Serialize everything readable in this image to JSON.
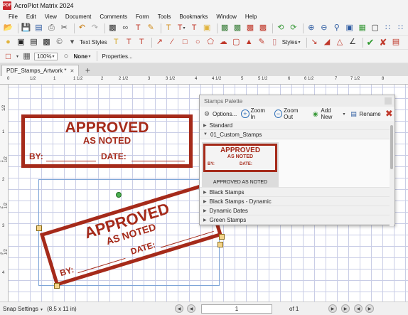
{
  "app": {
    "title": "AcroPlot Matrix 2024",
    "logo_text": "PDF"
  },
  "menu": [
    "File",
    "Edit",
    "View",
    "Document",
    "Comments",
    "Form",
    "Tools",
    "Bookmarks",
    "Window",
    "Help"
  ],
  "toolbar2": {
    "text_styles_label": "Text Styles",
    "styles_label": "Styles"
  },
  "toolbar3": {
    "zoom_value": "100%",
    "line_value": "None",
    "properties_label": "Properties..."
  },
  "tabs": {
    "active_label": "PDF_Stamps_Artwork *",
    "add_label": "+"
  },
  "ruler": {
    "h_labels": [
      "1/2",
      "1",
      "1 1/2",
      "2",
      "2 1/2",
      "3",
      "3 1/2",
      "4",
      "4 1/2",
      "5",
      "5 1/2",
      "6",
      "6 1/2",
      "7",
      "7 1/2",
      "8"
    ],
    "v_labels": [
      "1/2",
      "1",
      "1 1/2",
      "2",
      "2 1/2",
      "3",
      "3 1/2",
      "4"
    ]
  },
  "stamp_main": {
    "line1": "APPROVED",
    "line2": "AS NOTED",
    "by": "BY:",
    "date": "DATE:",
    "color": "#a52a1a"
  },
  "stamp_rotated": {
    "line1": "APPROVED",
    "line2": "AS NOTED",
    "by": "BY:",
    "date": "DATE:",
    "rotation_deg": -17
  },
  "palette": {
    "title": "Stamps Palette",
    "options_label": "Options...",
    "zoom_in_label": "Zoom In",
    "zoom_out_label": "Zoom Out",
    "add_new_label": "Add New",
    "rename_label": "Rename",
    "groups": {
      "standard": "Standard",
      "custom": "01_Custom_Stamps",
      "black": "Black Stamps",
      "black_dynamic": "Black Stamps - Dynamic",
      "dynamic_dates": "Dynamic Dates",
      "green": "Green Stamps"
    },
    "thumb": {
      "line1": "APPROVED",
      "line2": "AS NOTED",
      "by": "BY:",
      "date": "DATE:",
      "caption": "APPROVED AS NOTED"
    }
  },
  "status": {
    "snap_label": "Snap Settings",
    "page_size": "(8.5 x 11 in)",
    "page_number": "1",
    "page_total": "of 1"
  },
  "icons": [
    "open-folder-icon",
    "save-icon",
    "print-icon",
    "undo-icon",
    "redo-icon",
    "zoom-in-icon",
    "zoom-out-icon",
    "checkmark-icon",
    "delete-icon"
  ]
}
